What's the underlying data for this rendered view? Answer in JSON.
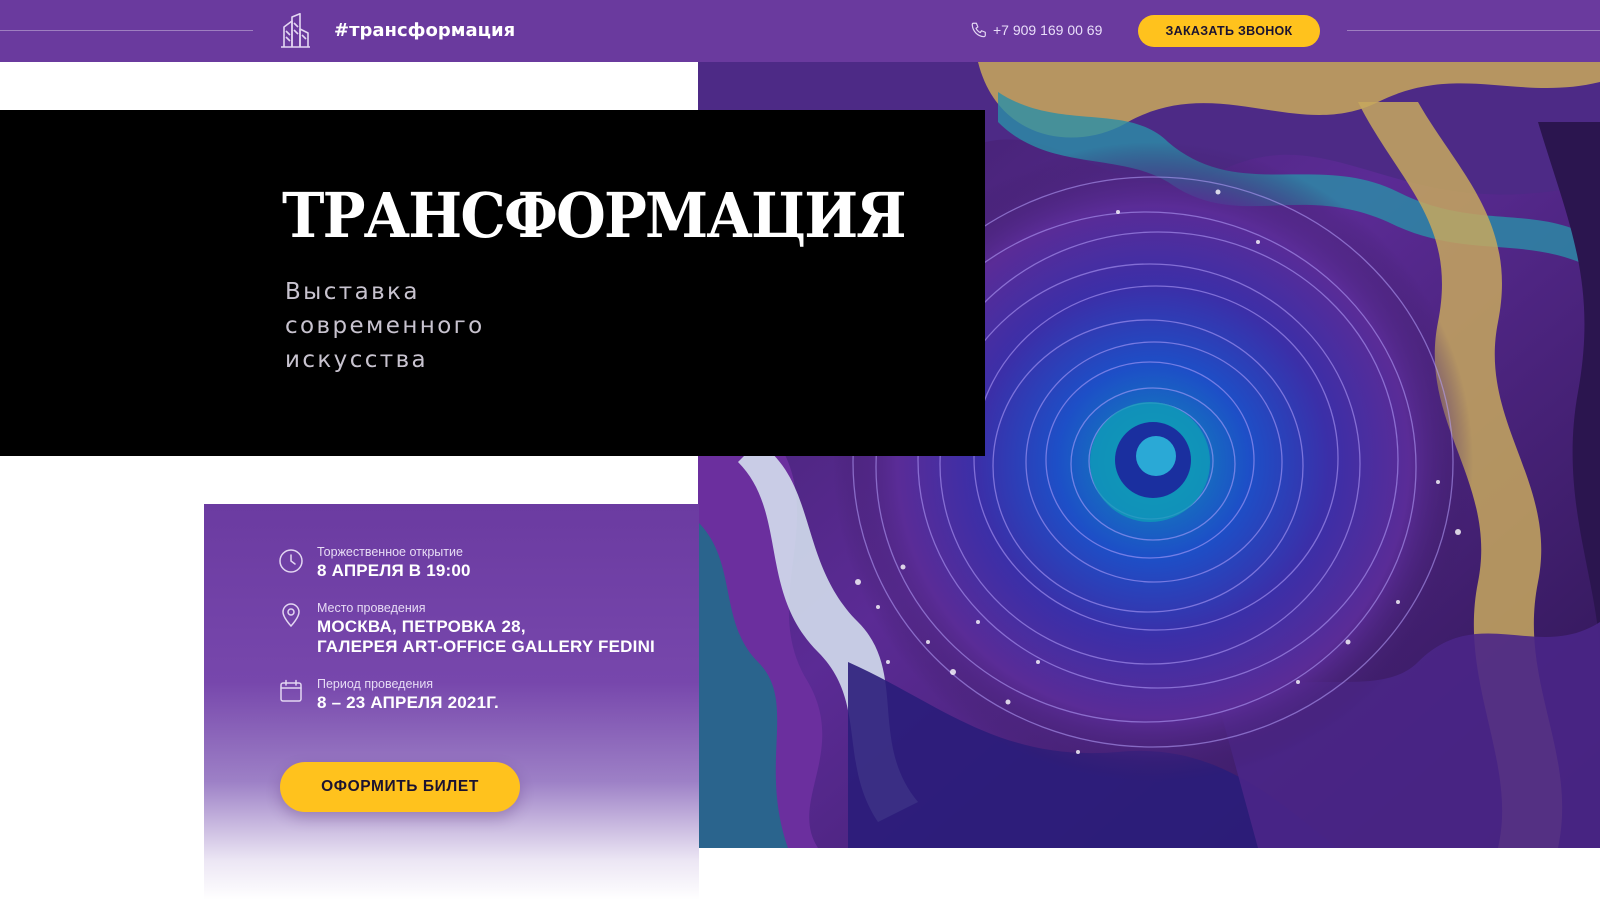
{
  "header": {
    "brand": "#трансформация",
    "phone": "+7 909 169 00 69",
    "call_button": "ЗАКАЗАТЬ ЗВОНОК"
  },
  "hero": {
    "title": "ТРАНСФОРМАЦИЯ",
    "subtitle": "Выставка\nсовременного\nискусства"
  },
  "info": {
    "opening": {
      "icon": "clock-icon",
      "label": "Торжественное открытие",
      "value": "8 АПРЕЛЯ В 19:00"
    },
    "venue": {
      "icon": "map-pin-icon",
      "label": "Место проведения",
      "value": "МОСКВА, ПЕТРОВКА 28,\nГАЛЕРЕЯ ART-OFFICE GALLERY FEDINI"
    },
    "period": {
      "icon": "calendar-icon",
      "label": "Период проведения",
      "value": "8 – 23 АПРЕЛЯ 2021Г."
    },
    "ticket_button": "ОФОРМИТЬ БИЛЕТ"
  },
  "colors": {
    "header_bg": "#6a3a9e",
    "accent_button": "#ffc21d",
    "title_panel_bg": "#000000",
    "card_purple": "#6b3ba1"
  }
}
